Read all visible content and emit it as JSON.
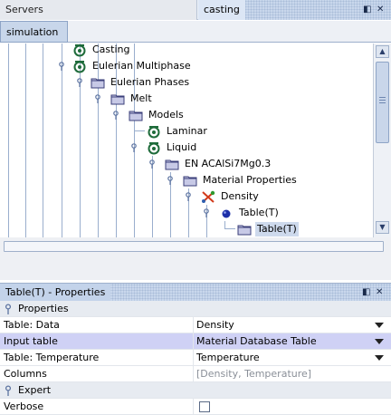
{
  "top_bar": {
    "servers_tab": "Servers",
    "casting_tab": "casting",
    "restore_icon": "◧",
    "close_icon": "✕"
  },
  "tabs": {
    "simulation": "simulation"
  },
  "tree": {
    "nodes": [
      {
        "label": "Casting",
        "icon": "continuum-icon"
      },
      {
        "label": "Eulerian Multiphase",
        "icon": "continuum-icon"
      },
      {
        "label": "Eulerian Phases",
        "icon": "folder-icon"
      },
      {
        "label": "Melt",
        "icon": "folder-icon"
      },
      {
        "label": "Models",
        "icon": "folder-icon"
      },
      {
        "label": "Laminar",
        "icon": "continuum-icon"
      },
      {
        "label": "Liquid",
        "icon": "continuum-icon"
      },
      {
        "label": "EN ACAlSi7Mg0.3",
        "icon": "folder-icon"
      },
      {
        "label": "Material Properties",
        "icon": "folder-icon"
      },
      {
        "label": "Density",
        "icon": "method-icon"
      },
      {
        "label": "Table(T)",
        "icon": "ball-icon"
      },
      {
        "label": "Table(T)",
        "icon": "folder-icon",
        "selected": true
      }
    ]
  },
  "properties": {
    "title": "Table(T) - Properties",
    "restore_icon": "◧",
    "close_icon": "✕",
    "category_properties": "Properties",
    "rows": [
      {
        "key": "Table: Data",
        "value": "Density",
        "dropdown": true
      },
      {
        "key": "Input table",
        "value": "Material Database Table",
        "dropdown": true,
        "highlighted": true
      },
      {
        "key": "Table: Temperature",
        "value": "Temperature",
        "dropdown": true
      },
      {
        "key": "Columns",
        "value": "[Density, Temperature]",
        "readonly": true
      }
    ],
    "category_expert": "Expert",
    "verbose_label": "Verbose",
    "verbose_checked": false
  },
  "colors": {
    "title_bg": "#c9d7ec",
    "selection": "#cdd9ec",
    "highlight_row": "#cfd1f5",
    "tree_lines": "#9aaecd"
  }
}
